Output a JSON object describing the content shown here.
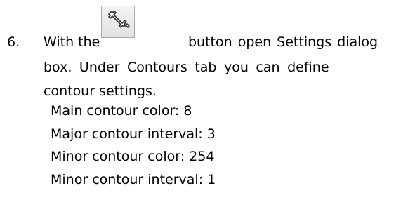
{
  "step": {
    "number": "6.",
    "text_before_icon": "With the",
    "button_icon": "wrench-icon",
    "text_after_icon": "button open Settings dialog",
    "line2": "box. Under Contours tab you can define",
    "line3": "contour settings."
  },
  "settings": [
    {
      "label": "Main contour color: 8"
    },
    {
      "label": "Major contour interval: 3"
    },
    {
      "label": "Minor contour color: 254"
    },
    {
      "label": "Minor contour interval: 1"
    }
  ]
}
